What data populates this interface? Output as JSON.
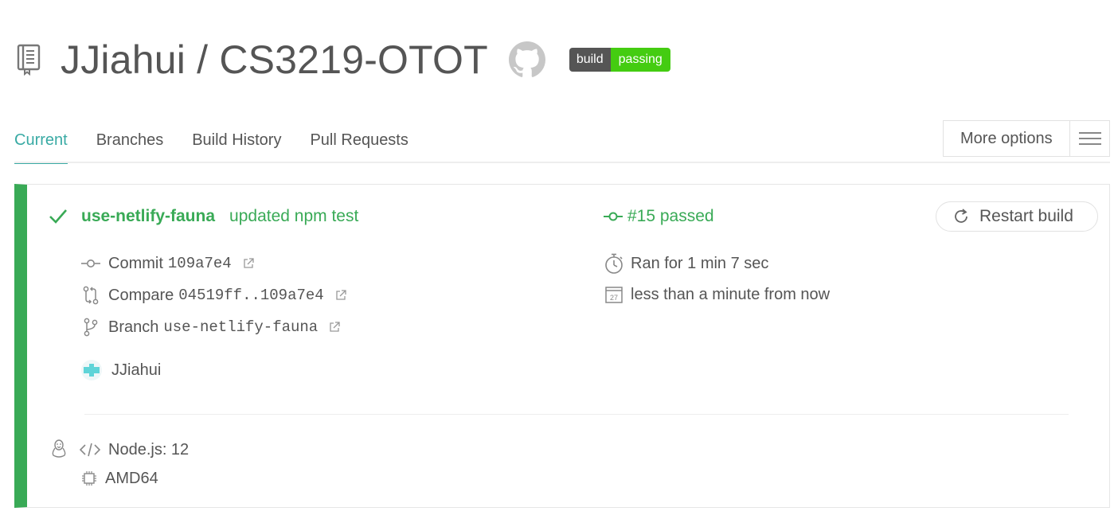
{
  "repo": {
    "owner": "JJiahui",
    "name": "CS3219-OTOT",
    "title": "JJiahui / CS3219-OTOT",
    "badge_label": "build",
    "badge_status": "passing"
  },
  "tabs": [
    {
      "label": "Current",
      "active": true
    },
    {
      "label": "Branches",
      "active": false
    },
    {
      "label": "Build History",
      "active": false
    },
    {
      "label": "Pull Requests",
      "active": false
    }
  ],
  "more_options": {
    "label": "More options"
  },
  "build": {
    "branch": "use-netlify-fauna",
    "message": "updated npm test",
    "status": "#15 passed",
    "restart_label": "Restart build",
    "commit_label": "Commit",
    "commit_sha": "109a7e4",
    "compare_label": "Compare",
    "compare_range": "04519ff..109a7e4",
    "branch_label": "Branch",
    "branch_name": "use-netlify-fauna",
    "duration": "Ran for 1 min 7 sec",
    "finished": "less than a minute from now",
    "calendar_day": "27",
    "author": "JJiahui",
    "language": "Node.js: 12",
    "arch": "AMD64"
  },
  "colors": {
    "passed": "#39aa56",
    "accent": "#39aaa4",
    "badge_green": "#44cc11",
    "badge_gray": "#555555"
  }
}
